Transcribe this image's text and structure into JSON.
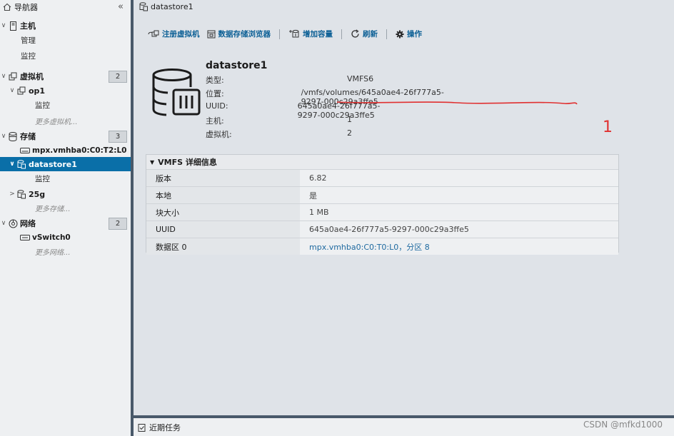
{
  "sidebar": {
    "title": "导航器",
    "collapse": "«",
    "items": [
      {
        "label": "主机"
      },
      {
        "label": "管理"
      },
      {
        "label": "监控"
      },
      {
        "label": "虚拟机",
        "count": "2"
      },
      {
        "label": "op1"
      },
      {
        "label": "监控"
      },
      {
        "label": "更多虚拟机..."
      },
      {
        "label": "存储",
        "count": "3"
      },
      {
        "label": "mpx.vmhba0:C0:T2:L0"
      },
      {
        "label": "datastore1"
      },
      {
        "label": "监控"
      },
      {
        "label": "25g"
      },
      {
        "label": "更多存储..."
      },
      {
        "label": "网络",
        "count": "2"
      },
      {
        "label": "vSwitch0"
      },
      {
        "label": "更多网络..."
      }
    ]
  },
  "main": {
    "tab_title": "datastore1",
    "toolbar": {
      "register_vm": "注册虚拟机",
      "browser": "数据存储浏览器",
      "increase": "增加容量",
      "refresh": "刷新",
      "actions": "操作"
    },
    "summary": {
      "name": "datastore1",
      "rows": [
        {
          "label": "类型:",
          "value": "VMFS6"
        },
        {
          "label": "位置:",
          "value": "/vmfs/volumes/645a0ae4-26f777a5-9297-000c29a3ffe5"
        },
        {
          "label": "UUID:",
          "value": "645a0ae4-26f777a5-9297-000c29a3ffe5"
        },
        {
          "label": "主机:",
          "value": "1"
        },
        {
          "label": "虚拟机:",
          "value": "2"
        }
      ]
    },
    "annotation": "1",
    "vmfs_panel": {
      "title": "VMFS 详细信息",
      "rows": [
        {
          "label": "版本",
          "value": "6.82"
        },
        {
          "label": "本地",
          "value": "是"
        },
        {
          "label": "块大小",
          "value": "1 MB"
        },
        {
          "label": "UUID",
          "value": "645a0ae4-26f777a5-9297-000c29a3ffe5"
        },
        {
          "label": "数据区 0",
          "value": "mpx.vmhba0:C0:T0:L0，分区 8"
        }
      ]
    }
  },
  "bottom": {
    "recent_tasks": "近期任务"
  },
  "watermark": "CSDN @mfkd1000",
  "colors": {
    "selected": "#0a6fa8",
    "link": "#0b5f95",
    "annotation": "#e03030",
    "divider": "#49596a"
  }
}
